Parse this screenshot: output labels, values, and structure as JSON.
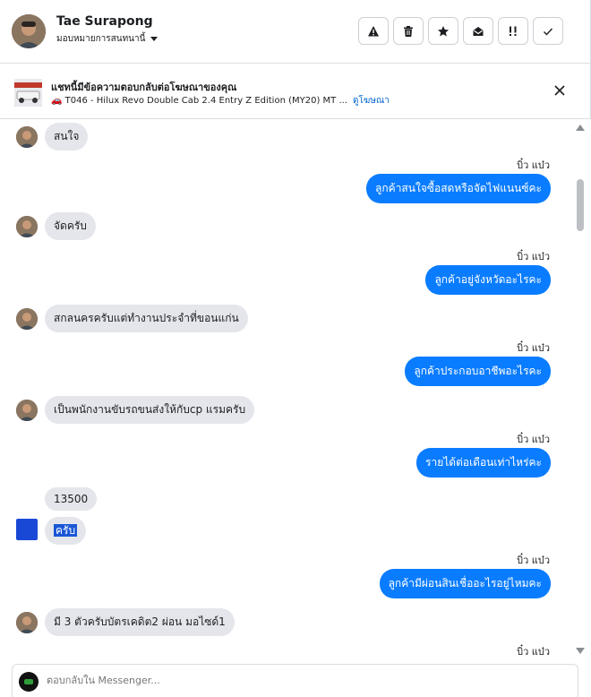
{
  "header": {
    "name": "Tae Surapong",
    "assign_label": "มอบหมายการสนทนานี้",
    "actions": [
      "warning-icon",
      "trash-icon",
      "star-icon",
      "mark-read-icon",
      "priority-icon",
      "check-icon"
    ]
  },
  "ad": {
    "title": "แชทนี้มีข้อความตอบกลับต่อโฆษณาของคุณ",
    "subtitle": "🚗 T046 - Hilux Revo Double Cab 2.4 Entry Z Edition (MY20) MT ...",
    "link": "ดูโฆษณา"
  },
  "messages": [
    {
      "dir": "in",
      "text": "สนใจ"
    },
    {
      "dir": "out",
      "sender": "บิ๋ว แบ๋ว",
      "text": "ลูกค้าสนใจซื้อสดหรือจัดไฟแนนซ์คะ"
    },
    {
      "dir": "in",
      "text": "จัดครับ"
    },
    {
      "dir": "out",
      "sender": "บิ๋ว แบ๋ว",
      "text": "ลูกค้าอยู่จังหวัดอะไรคะ"
    },
    {
      "dir": "in",
      "text": "สกลนครครับแต่ทำงานประจำที่ขอนแก่น"
    },
    {
      "dir": "out",
      "sender": "บิ๋ว แบ๋ว",
      "text": "ลูกค้าประกอบอาชีพอะไรคะ"
    },
    {
      "dir": "in",
      "text": "เป็นพนักงานขับรถขนส่งให้กับcp แรมครับ"
    },
    {
      "dir": "out",
      "sender": "บิ๋ว แบ๋ว",
      "text": "รายได้ต่อเดือนเท่าไหร่คะ"
    },
    {
      "dir": "in",
      "text": "13500"
    },
    {
      "dir": "in",
      "text": "ครับ"
    },
    {
      "dir": "out",
      "sender": "บิ๋ว แบ๋ว",
      "text": "ลูกค้ามีผ่อนสินเชื่ออะไรอยู่ไหมคะ"
    },
    {
      "dir": "in",
      "text": "มี 3 ตัวครับบัตรเคดิต2 ผ่อน มอไซด์1"
    },
    {
      "dir": "out",
      "sender": "บิ๋ว แบ๋ว",
      "text": ""
    }
  ],
  "composer": {
    "placeholder": "ตอบกลับใน Messenger..."
  }
}
